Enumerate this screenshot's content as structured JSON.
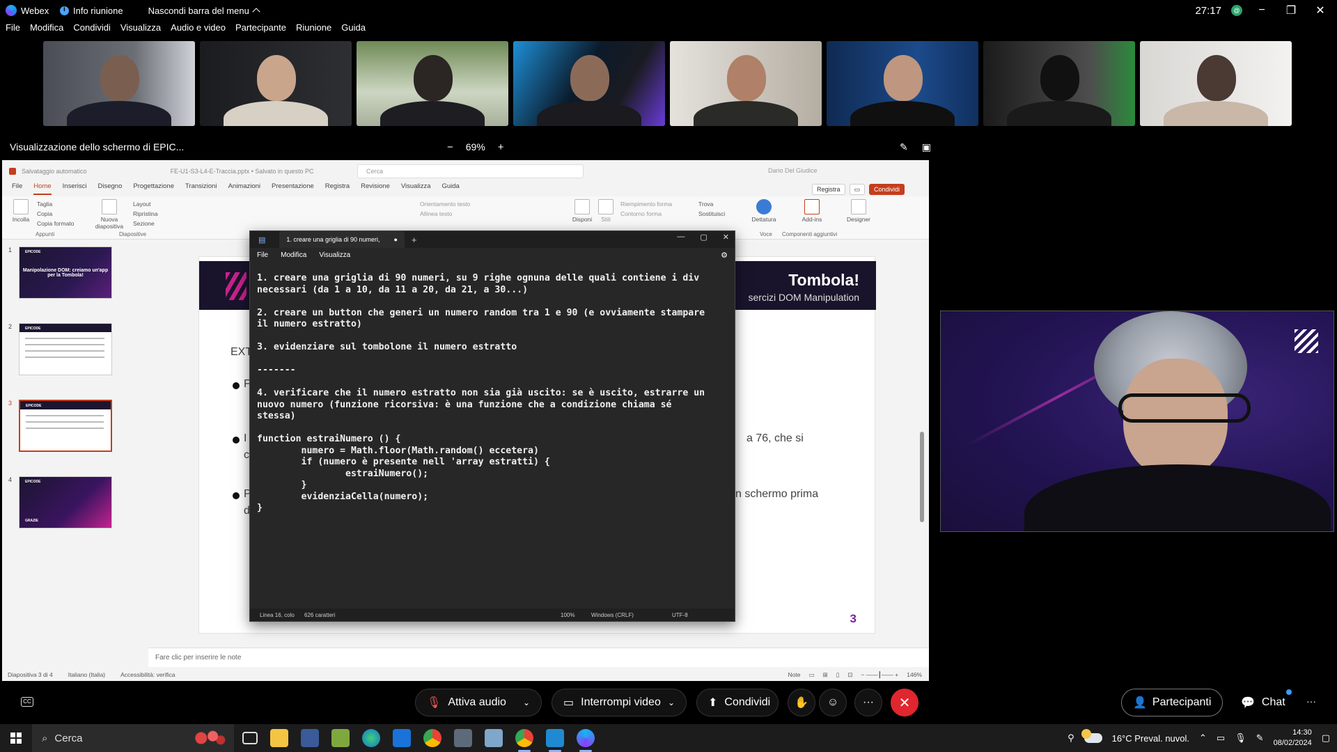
{
  "webex": {
    "app_name": "Webex",
    "meeting_info": "Info riunione",
    "hide_menu": "Nascondi barra del menu",
    "timer": "27:17",
    "avatar_initial": "@",
    "menu": [
      "File",
      "Modifica",
      "Condividi",
      "Visualizza",
      "Audio e video",
      "Partecipante",
      "Riunione",
      "Guida"
    ],
    "share_title": "Visualizzazione dello schermo di EPIC...",
    "zoom_minus": "−",
    "zoom_level": "69%",
    "zoom_plus": "+",
    "controls": {
      "audio": "Attiva audio",
      "video": "Interrompi video",
      "share": "Condividi",
      "participants": "Partecipanti",
      "chat": "Chat",
      "more": "···"
    }
  },
  "powerpoint": {
    "autosave": "Salvataggio automatico",
    "filename": "FE-U1-S3-L4-E-Traccia.pptx • Salvato in questo PC",
    "search_placeholder": "Cerca",
    "user": "Dario Del Giudice",
    "tabs": [
      "File",
      "Home",
      "Inserisci",
      "Disegno",
      "Progettazione",
      "Transizioni",
      "Animazioni",
      "Presentazione",
      "Registra",
      "Revisione",
      "Visualizza",
      "Guida"
    ],
    "record_btn": "Registra",
    "share_btn": "Condividi",
    "ribbon": {
      "paste": "Incolla",
      "cut": "Taglia",
      "copy": "Copia",
      "format_painter": "Copia formato",
      "clipboard": "Appunti",
      "new_slide": "Nuova diapositiva",
      "layout": "Layout",
      "reset": "Ripristina",
      "section": "Sezione",
      "slides": "Diapositive",
      "text_direction": "Orientamento testo",
      "align_text": "Allinea testo",
      "arrange": "Disponi",
      "styles": "Stili",
      "shape_fill": "Riempimento forma",
      "shape_outline": "Contorno forma",
      "find": "Trova",
      "replace": "Sostituisci",
      "dictate": "Dettatura",
      "voice": "Voce",
      "addins": "Add-ins",
      "addins_group": "Componenti aggiuntivi",
      "designer": "Designer"
    },
    "thumbnails": [
      {
        "num": "1",
        "brand": "EPICODE",
        "title": "Manipolazione DOM: creiamo un'app per la Tombola!"
      },
      {
        "num": "2",
        "brand": "EPICODE"
      },
      {
        "num": "3",
        "brand": "EPICODE"
      },
      {
        "num": "4",
        "brand": "EPICODE",
        "title": "GRAZIE"
      }
    ],
    "slide": {
      "title": "Tombola!",
      "subtitle": "sercizi DOM Manipulation",
      "partial_left": "EXT",
      "bullet1": "F",
      "bullet2": "I",
      "bullet2_right": "a 76, che si",
      "bullet2_second": "c",
      "bullet3": "P",
      "bullet3_right": "n schermo prima",
      "bullet3_second": "d",
      "page_number": "3"
    },
    "notes_placeholder": "Fare clic per inserire le note",
    "status": {
      "slide": "Diapositiva 3 di 4",
      "language": "Italiano (Italia)",
      "accessibility": "Accessibilità: verifica",
      "notes": "Note",
      "zoom": "146%"
    }
  },
  "notepad": {
    "tab_title": "1. creare una griglia di 90 numeri,",
    "menu": [
      "File",
      "Modifica",
      "Visualizza"
    ],
    "content": "1. creare una griglia di 90 numeri, su 9 righe ognuna delle quali contiene i div\nnecessari (da 1 a 10, da 11 a 20, da 21, a 30...)\n\n2. creare un button che generi un numero random tra 1 e 90 (e ovviamente stampare\nil numero estratto)\n\n3. evidenziare sul tombolone il numero estratto\n\n-------\n\n4. verificare che il numero estratto non sia già uscito: se è uscito, estrarre un\nnuovo numero (funzione ricorsiva: è una funzione che a condizione chiama sé\nstessa)\n\nfunction estraiNumero () {\n        numero = Math.floor(Math.random() eccetera)\n        if (numero è presente nell 'array estratti) {\n                estraiNumero();\n        }\n        evidenziaCella(numero);\n}",
    "status": {
      "position": "Linea 16, colo",
      "chars": "626 caratteri",
      "zoom": "100%",
      "eol": "Windows (CRLF)",
      "encoding": "UTF-8"
    }
  },
  "taskbar": {
    "search": "Cerca",
    "weather": "16°C  Preval. nuvol.",
    "time": "14:30",
    "date": "08/02/2024"
  }
}
